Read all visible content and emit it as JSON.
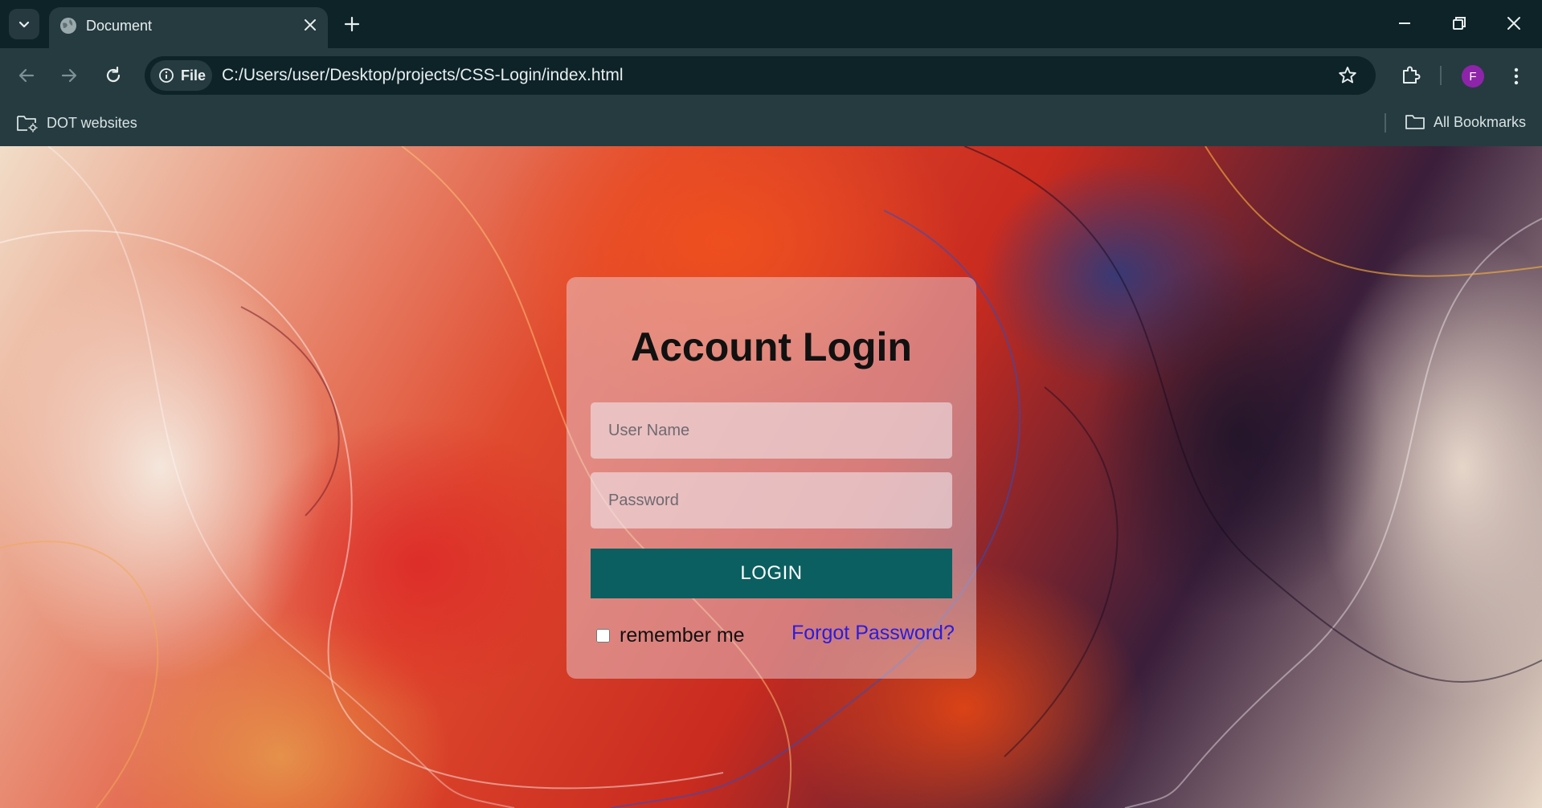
{
  "browser": {
    "tab": {
      "title": "Document"
    },
    "address": {
      "scheme_chip": "File",
      "url": "C:/Users/user/Desktop/projects/CSS-Login/index.html"
    },
    "profile_initial": "F",
    "bookmarks": {
      "left": "DOT websites",
      "right": "All Bookmarks"
    }
  },
  "login": {
    "title": "Account Login",
    "username_placeholder": "User Name",
    "password_placeholder": "Password",
    "submit_label": "LOGIN",
    "remember_label": "remember me",
    "forgot_label": "Forgot Password?"
  },
  "colors": {
    "chrome_dark": "#0d2328",
    "chrome_mid": "#253b40",
    "login_button": "#0b5f60",
    "link": "#2a1be0",
    "avatar": "#8e24aa"
  }
}
